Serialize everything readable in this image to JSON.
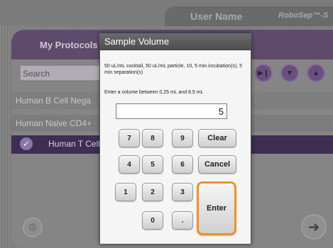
{
  "header": {
    "user_name": "User Name",
    "brand": "RoboSep™-S"
  },
  "protocols": {
    "title": "My Protocols",
    "search_placeholder": "Search",
    "rows": [
      {
        "label": "Human B Cell Nega"
      },
      {
        "label": "Human Naive CD4+"
      },
      {
        "label": "Human T Cell",
        "selected": true
      }
    ]
  },
  "dialog": {
    "title": "Sample Volume",
    "description": "50 uL/mL cocktail, 50 uL/mL particle, 10, 5 min incubation(s), 5 min separation(s)",
    "prompt": "Enter a volume between 0.25 mL and 8.5 mL",
    "value": "5",
    "keys": {
      "k7": "7",
      "k8": "8",
      "k9": "9",
      "k4": "4",
      "k5": "5",
      "k6": "6",
      "k1": "1",
      "k2": "2",
      "k3": "3",
      "k0": "0",
      "dot": ".",
      "clear": "Clear",
      "cancel": "Cancel",
      "enter": "Enter"
    }
  },
  "icons": {
    "check": "check-icon",
    "gear": "gear-icon",
    "next": "arrow-right-icon",
    "play": "play-icon",
    "down": "chevron-down-icon",
    "up": "chevron-up-icon"
  },
  "colors": {
    "accent_purple": "#5e4b6c",
    "selected_row": "#3f2d52",
    "enter_highlight": "#f0922a"
  }
}
